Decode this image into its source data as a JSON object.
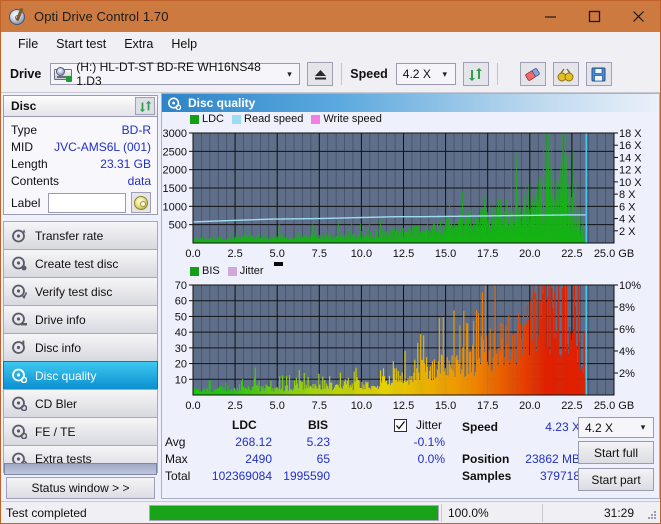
{
  "window": {
    "title": "Opti Drive Control 1.70",
    "title_icon": "disc-pen-icon",
    "minimize": "minimize-icon",
    "maximize": "maximize-icon",
    "close": "close-icon",
    "titlebar_color": "#cc7a3f"
  },
  "menu": {
    "items": [
      "File",
      "Start test",
      "Extra",
      "Help"
    ]
  },
  "toolbar": {
    "drive_label": "Drive",
    "drive_value": "(H:)  HL-DT-ST BD-RE  WH16NS48 1.D3",
    "eject_icon": "eject-icon",
    "speed_label": "Speed",
    "speed_value": "4.2 X",
    "refresh_icon": "refresh-icon",
    "erase_icon": "eraser-icon",
    "scan_icon": "binoculars-icon",
    "save_icon": "save-icon"
  },
  "disc": {
    "header": "Disc",
    "refresh_icon": "refresh-icon",
    "rows": [
      {
        "key": "Type",
        "value": "BD-R"
      },
      {
        "key": "MID",
        "value": "JVC-AMS6L (001)"
      },
      {
        "key": "Length",
        "value": "23.31 GB"
      },
      {
        "key": "Contents",
        "value": "data"
      }
    ],
    "label_key": "Label",
    "label_value": "",
    "label_placeholder": "",
    "label_button_icon": "cd-icon"
  },
  "nav": {
    "items": [
      {
        "label": "Transfer rate",
        "icon": "disc-transfer-icon",
        "active": false
      },
      {
        "label": "Create test disc",
        "icon": "disc-create-icon",
        "active": false
      },
      {
        "label": "Verify test disc",
        "icon": "disc-verify-icon",
        "active": false
      },
      {
        "label": "Drive info",
        "icon": "disc-drive-icon",
        "active": false
      },
      {
        "label": "Disc info",
        "icon": "disc-info-icon",
        "active": false
      },
      {
        "label": "Disc quality",
        "icon": "disc-quality-icon",
        "active": true
      },
      {
        "label": "CD Bler",
        "icon": "disc-bler-icon",
        "active": false
      },
      {
        "label": "FE / TE",
        "icon": "disc-fete-icon",
        "active": false
      },
      {
        "label": "Extra tests",
        "icon": "disc-extra-icon",
        "active": false
      }
    ],
    "status_window_button": "Status window > >"
  },
  "panel": {
    "title": "Disc quality",
    "title_icon": "disc-quality-icon"
  },
  "stats": {
    "col_ldc": "LDC",
    "col_bis": "BIS",
    "rows": [
      {
        "label": "Avg",
        "ldc": "268.12",
        "bis": "5.23",
        "jitter": "-0.1%"
      },
      {
        "label": "Max",
        "ldc": "2490",
        "bis": "65",
        "jitter": "0.0%"
      },
      {
        "label": "Total",
        "ldc": "102369084",
        "bis": "1995590",
        "jitter": ""
      }
    ],
    "jitter_label": "Jitter",
    "jitter_checked": true,
    "speed_label": "Speed",
    "speed_value": "4.23 X",
    "position_label": "Position",
    "position_value": "23862 MB",
    "samples_label": "Samples",
    "samples_value": "379718",
    "speed_select": "4.2 X",
    "start_full": "Start full",
    "start_part": "Start part"
  },
  "statusbar": {
    "message": "Test completed",
    "progress_text": "100.0%",
    "progress_percent": 100,
    "elapsed": "31:29",
    "progress_color": "#18a319"
  },
  "chart_data": [
    {
      "type": "area",
      "id": "ldc-chart",
      "title": "",
      "xlabel": "GB",
      "ylabel": "",
      "xlim": [
        0.0,
        25.0
      ],
      "xticks": [
        0.0,
        2.5,
        5.0,
        7.5,
        10.0,
        12.5,
        15.0,
        17.5,
        20.0,
        22.5,
        25.0
      ],
      "xticklabels": [
        "0.0",
        "2.5",
        "5.0",
        "7.5",
        "10.0",
        "12.5",
        "15.0",
        "17.5",
        "20.0",
        "22.5",
        "25.0 GB"
      ],
      "ylim": [
        0,
        3000
      ],
      "yticks": [
        500,
        1000,
        1500,
        2000,
        2500,
        3000
      ],
      "yticklabels": [
        "500",
        "1000",
        "1500",
        "2000",
        "2500",
        "3000"
      ],
      "y2lim": [
        0,
        18
      ],
      "y2ticks": [
        2,
        4,
        6,
        8,
        10,
        12,
        14,
        16,
        18
      ],
      "y2ticklabels": [
        "2 X",
        "4 X",
        "6 X",
        "8 X",
        "10 X",
        "12 X",
        "14 X",
        "16 X",
        "18 X"
      ],
      "grid": true,
      "plot_bg": "#5f6e89",
      "legend_position": "top-left",
      "legend": [
        {
          "name": "LDC",
          "color": "#14a014"
        },
        {
          "name": "Read speed",
          "color": "#9fdcf4"
        },
        {
          "name": "Write speed",
          "color": "#f57ce0"
        }
      ],
      "series": [
        {
          "name": "LDC",
          "color": "#14b414",
          "kind": "area",
          "x": [
            0.0,
            0.3,
            0.6,
            0.9,
            1.2,
            1.5,
            1.8,
            2.1,
            2.4,
            2.7,
            3.0,
            3.3,
            3.6,
            3.9,
            4.2,
            4.5,
            4.8,
            5.1,
            5.4,
            5.7,
            6.0,
            6.3,
            6.6,
            6.9,
            7.2,
            7.5,
            7.8,
            8.1,
            8.4,
            8.7,
            9.0,
            9.3,
            9.6,
            9.9,
            10.2,
            10.5,
            10.8,
            11.1,
            11.4,
            11.7,
            12.0,
            12.3,
            12.6,
            12.9,
            13.2,
            13.5,
            13.8,
            14.1,
            14.4,
            14.7,
            15.0,
            15.3,
            15.6,
            15.9,
            16.2,
            16.5,
            16.8,
            17.1,
            17.4,
            17.7,
            18.0,
            18.3,
            18.6,
            18.9,
            19.2,
            19.5,
            19.8,
            20.1,
            20.4,
            20.7,
            21.0,
            21.3,
            21.6,
            21.9,
            22.2,
            22.5,
            22.8,
            23.1,
            23.3
          ],
          "y": [
            120,
            150,
            120,
            170,
            140,
            230,
            150,
            130,
            160,
            180,
            150,
            210,
            160,
            230,
            180,
            150,
            190,
            240,
            170,
            200,
            180,
            230,
            200,
            190,
            320,
            200,
            260,
            230,
            210,
            250,
            230,
            260,
            240,
            270,
            260,
            290,
            280,
            310,
            300,
            330,
            320,
            360,
            380,
            400,
            430,
            470,
            440,
            520,
            560,
            600,
            580,
            640,
            700,
            720,
            680,
            760,
            820,
            900,
            860,
            940,
            1000,
            1080,
            1040,
            1160,
            1240,
            1320,
            1280,
            1400,
            1500,
            1680,
            1900,
            2100,
            1980,
            1820,
            1600,
            1400,
            1050,
            700,
            140
          ]
        },
        {
          "name": "Read speed",
          "color": "#9fdcf4",
          "kind": "line",
          "x": [
            0.0,
            1.5,
            3.0,
            4.5,
            6.0,
            7.5,
            9.0,
            10.5,
            12.0,
            13.5,
            15.0,
            16.5,
            18.0,
            19.5,
            21.0,
            22.5,
            23.2
          ],
          "y_speed_x": [
            3.45,
            3.6,
            3.75,
            3.9,
            3.95,
            4.0,
            4.1,
            4.2,
            4.3,
            4.3,
            4.35,
            4.4,
            4.45,
            4.5,
            4.55,
            4.6,
            4.6
          ]
        },
        {
          "name": "Cursor",
          "color": "#3fd0f4",
          "kind": "vline",
          "x": 23.35
        }
      ]
    },
    {
      "type": "area",
      "id": "bis-chart",
      "title": "",
      "xlabel": "GB",
      "xlim": [
        0.0,
        25.0
      ],
      "xticks": [
        0.0,
        2.5,
        5.0,
        7.5,
        10.0,
        12.5,
        15.0,
        17.5,
        20.0,
        22.5,
        25.0
      ],
      "xticklabels": [
        "0.0",
        "2.5",
        "5.0",
        "7.5",
        "10.0",
        "12.5",
        "15.0",
        "17.5",
        "20.0",
        "22.5",
        "25.0 GB"
      ],
      "ylim": [
        0,
        70
      ],
      "yticks": [
        10,
        20,
        30,
        40,
        50,
        60,
        70
      ],
      "yticklabels": [
        "10",
        "20",
        "30",
        "40",
        "50",
        "60",
        "70"
      ],
      "y2lim": [
        0,
        10
      ],
      "y2ticks": [
        2,
        4,
        6,
        8,
        10
      ],
      "y2ticklabels": [
        "2%",
        "4%",
        "6%",
        "8%",
        "10%"
      ],
      "grid": true,
      "plot_bg": "#5f6e89",
      "legend_position": "top-left",
      "legend": [
        {
          "name": "BIS",
          "color": "#14a014"
        },
        {
          "name": "Jitter",
          "color": "#d0a8d8"
        }
      ],
      "series": [
        {
          "name": "BIS",
          "kind": "area-gradient",
          "colors": [
            "#22c412",
            "#9ed410",
            "#e8d000",
            "#f09000",
            "#e02000"
          ],
          "x": [
            0.0,
            0.3,
            0.6,
            0.9,
            1.2,
            1.5,
            1.8,
            2.1,
            2.4,
            2.7,
            3.0,
            3.3,
            3.6,
            3.9,
            4.2,
            4.5,
            4.8,
            5.1,
            5.4,
            5.7,
            6.0,
            6.3,
            6.6,
            6.9,
            7.2,
            7.5,
            7.8,
            8.1,
            8.4,
            8.7,
            9.0,
            9.3,
            9.6,
            9.9,
            10.2,
            10.5,
            10.8,
            11.1,
            11.4,
            11.7,
            12.0,
            12.3,
            12.6,
            12.9,
            13.2,
            13.5,
            13.8,
            14.1,
            14.4,
            14.7,
            15.0,
            15.3,
            15.6,
            15.9,
            16.2,
            16.5,
            16.8,
            17.1,
            17.4,
            17.7,
            18.0,
            18.3,
            18.6,
            18.9,
            19.2,
            19.5,
            19.8,
            20.1,
            20.4,
            20.7,
            21.0,
            21.3,
            21.6,
            21.9,
            22.2,
            22.5,
            22.8,
            23.1,
            23.3
          ],
          "y": [
            2,
            4,
            3,
            5,
            3,
            7,
            4,
            3,
            5,
            4,
            6,
            5,
            9,
            4,
            6,
            5,
            4,
            7,
            5,
            6,
            5,
            8,
            6,
            5,
            7,
            6,
            5,
            8,
            7,
            6,
            9,
            7,
            8,
            7,
            9,
            8,
            11,
            9,
            12,
            10,
            14,
            12,
            16,
            13,
            18,
            20,
            17,
            22,
            19,
            24,
            21,
            26,
            24,
            28,
            26,
            30,
            28,
            34,
            32,
            38,
            36,
            42,
            40,
            46,
            44,
            50,
            48,
            54,
            58,
            62,
            60,
            66,
            64,
            58,
            54,
            48,
            40,
            24,
            12
          ]
        },
        {
          "name": "Cursor",
          "color": "#3fd0f4",
          "kind": "vline",
          "x": 23.35
        }
      ]
    }
  ]
}
